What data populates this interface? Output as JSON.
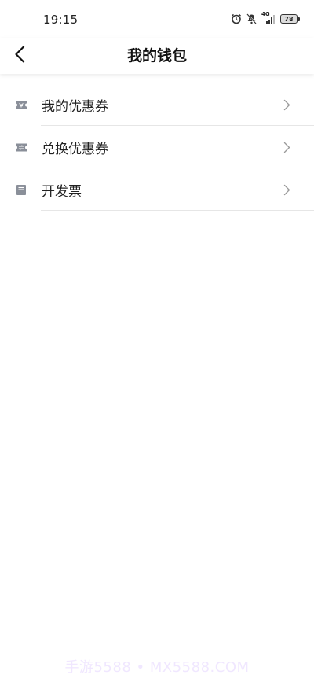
{
  "status_bar": {
    "time": "19:15",
    "network": "4G",
    "battery": "78",
    "icons": [
      "alarm-icon",
      "mute-bell-icon",
      "signal-icon",
      "battery-icon"
    ]
  },
  "header": {
    "title": "我的钱包",
    "back_icon": "chevron-left-icon"
  },
  "menu": {
    "items": [
      {
        "label": "我的优惠券",
        "icon": "coupon-icon"
      },
      {
        "label": "兑换优惠券",
        "icon": "coupon-exchange-icon"
      },
      {
        "label": "开发票",
        "icon": "invoice-icon"
      }
    ]
  },
  "watermark": "手游5588 • MX5588.COM",
  "colors": {
    "background": "#ffffff",
    "text": "#222222",
    "divider": "#e6e6e6",
    "icon": "#8a8f99",
    "arrow": "#9a9a9a"
  }
}
